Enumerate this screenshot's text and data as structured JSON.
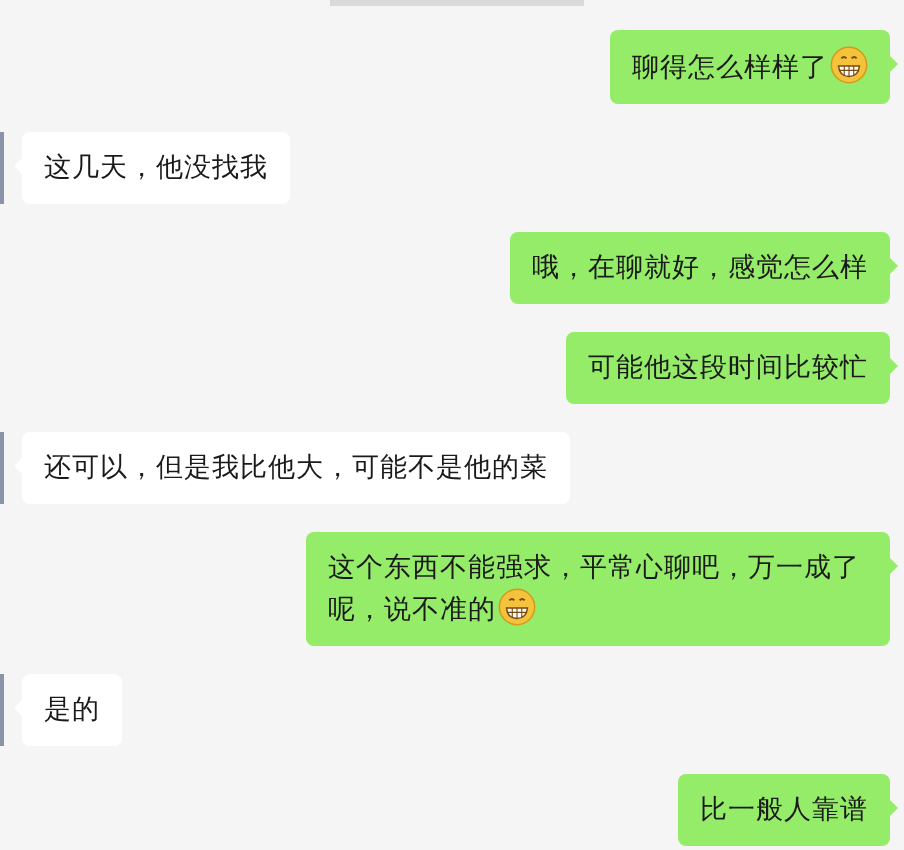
{
  "messages": [
    {
      "kind": "outgoing",
      "text": "聊得怎么样样了",
      "emoji": true
    },
    {
      "kind": "incoming",
      "text": "这几天，他没找我"
    },
    {
      "kind": "outgoing",
      "text": "哦，在聊就好，感觉怎么样"
    },
    {
      "kind": "outgoing",
      "text": "可能他这段时间比较忙"
    },
    {
      "kind": "incoming",
      "text": "还可以，但是我比他大，可能不是他的菜"
    },
    {
      "kind": "outgoing",
      "text": "这个东西不能强求，平常心聊吧，万一成了呢，说不准的",
      "emoji": true
    },
    {
      "kind": "incoming",
      "text": "是的"
    },
    {
      "kind": "outgoing",
      "text": "比一般人靠谱"
    }
  ]
}
